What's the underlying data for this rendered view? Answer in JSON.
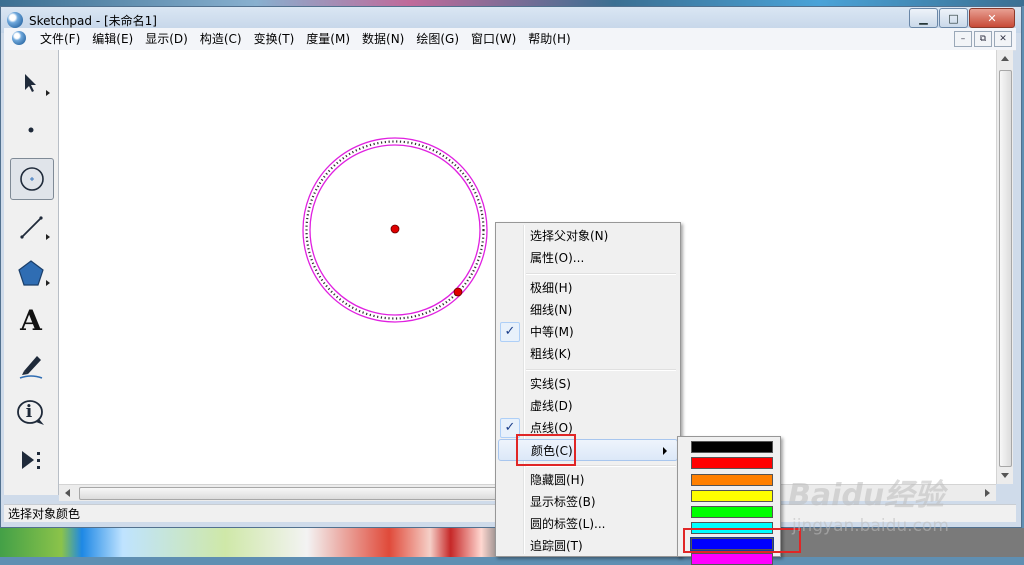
{
  "window": {
    "title": "Sketchpad  - [未命名1]"
  },
  "caption_buttons": {
    "minimize": "▁",
    "maximize": "□",
    "close": "✕"
  },
  "menubar": {
    "items": [
      "文件(F)",
      "编辑(E)",
      "显示(D)",
      "构造(C)",
      "变换(T)",
      "度量(M)",
      "数据(N)",
      "绘图(G)",
      "窗口(W)",
      "帮助(H)"
    ]
  },
  "mdi_buttons": {
    "minimize": "–",
    "restore": "⧉",
    "close": "✕"
  },
  "toolbox": {
    "tools": [
      {
        "name": "arrow-select-tool",
        "icon": "arrow-icon",
        "active": false,
        "has_submenu": true
      },
      {
        "name": "point-tool",
        "icon": "point-icon",
        "active": false,
        "has_submenu": false
      },
      {
        "name": "compass-tool",
        "icon": "circle-icon",
        "active": true,
        "has_submenu": false
      },
      {
        "name": "straightedge-tool",
        "icon": "segment-icon",
        "active": false,
        "has_submenu": true
      },
      {
        "name": "polygon-tool",
        "icon": "pentagon-icon",
        "active": false,
        "has_submenu": true
      },
      {
        "name": "text-tool",
        "icon": "text-a-icon",
        "label": "A",
        "active": false,
        "has_submenu": false
      },
      {
        "name": "marker-tool",
        "icon": "marker-pen-icon",
        "active": false,
        "has_submenu": false
      },
      {
        "name": "information-tool",
        "icon": "info-icon",
        "label": "i",
        "active": false,
        "has_submenu": false
      },
      {
        "name": "custom-tool",
        "icon": "play-more-icon",
        "active": false,
        "has_submenu": false
      }
    ]
  },
  "context_menu": {
    "items": [
      {
        "label": "选择父对象(N)",
        "checked": false
      },
      {
        "label": "属性(O)...",
        "checked": false
      },
      {
        "label": "极细(H)",
        "checked": false
      },
      {
        "label": "细线(N)",
        "checked": false
      },
      {
        "label": "中等(M)",
        "checked": true
      },
      {
        "label": "粗线(K)",
        "checked": false
      },
      {
        "label": "实线(S)",
        "checked": false
      },
      {
        "label": "虚线(D)",
        "checked": false
      },
      {
        "label": "点线(O)",
        "checked": true
      },
      {
        "label": "颜色(C)",
        "checked": false,
        "submenu": true,
        "hovered": true
      },
      {
        "label": "隐藏圆(H)",
        "checked": false
      },
      {
        "label": "显示标签(B)",
        "checked": false
      },
      {
        "label": "圆的标签(L)...",
        "checked": false
      },
      {
        "label": "追踪圆(T)",
        "checked": false
      }
    ],
    "check_glyph": "✓"
  },
  "color_submenu": {
    "swatches": [
      {
        "color": "#000000",
        "selected": false
      },
      {
        "color": "#ff0000",
        "selected": false
      },
      {
        "color": "#ff8000",
        "selected": false
      },
      {
        "color": "#ffff00",
        "selected": false
      },
      {
        "color": "#00ff00",
        "selected": false
      },
      {
        "color": "#00ffff",
        "selected": false
      },
      {
        "color": "#0000ff",
        "selected": true
      },
      {
        "color": "#ff00ff",
        "selected": false
      }
    ]
  },
  "canvas": {
    "circle_color": "#e020e0",
    "point_color": "#e00000"
  },
  "statusbar": {
    "text": "选择对象颜色"
  },
  "watermark": {
    "brand": "Baidu经验",
    "url": "jingyan.baidu.com"
  }
}
